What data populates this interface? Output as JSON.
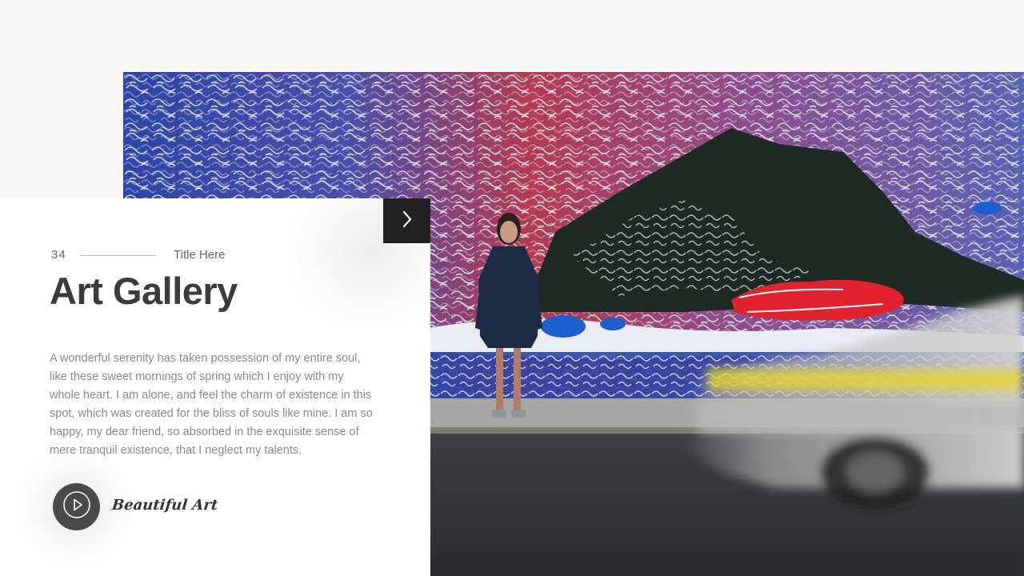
{
  "slide": {
    "number": "34",
    "title_small": "Title Here",
    "title": "Art Gallery",
    "body": "A wonderful serenity has taken possession of my entire soul, like these sweet mornings of spring which I enjoy with my whole heart. I am alone, and feel the charm of existence in this spot, which was created for the bliss of souls like mine. I am so happy, my dear friend, so absorbed in the exquisite sense of mere tranquil existence, that I neglect my talents.",
    "play_caption": "Beautiful Art"
  },
  "icons": {
    "next": "chevron-right-icon",
    "play": "play-icon"
  },
  "colors": {
    "background": "#f7f7f7",
    "card": "#ffffff",
    "next_button": "#222222",
    "play_button": "#4a4a4a",
    "title": "#3b3b3b",
    "body_text": "#8a8a8a",
    "mural_blue": "#2f46a8",
    "mural_red": "#c23a4a",
    "mural_dark": "#1f2a24"
  }
}
